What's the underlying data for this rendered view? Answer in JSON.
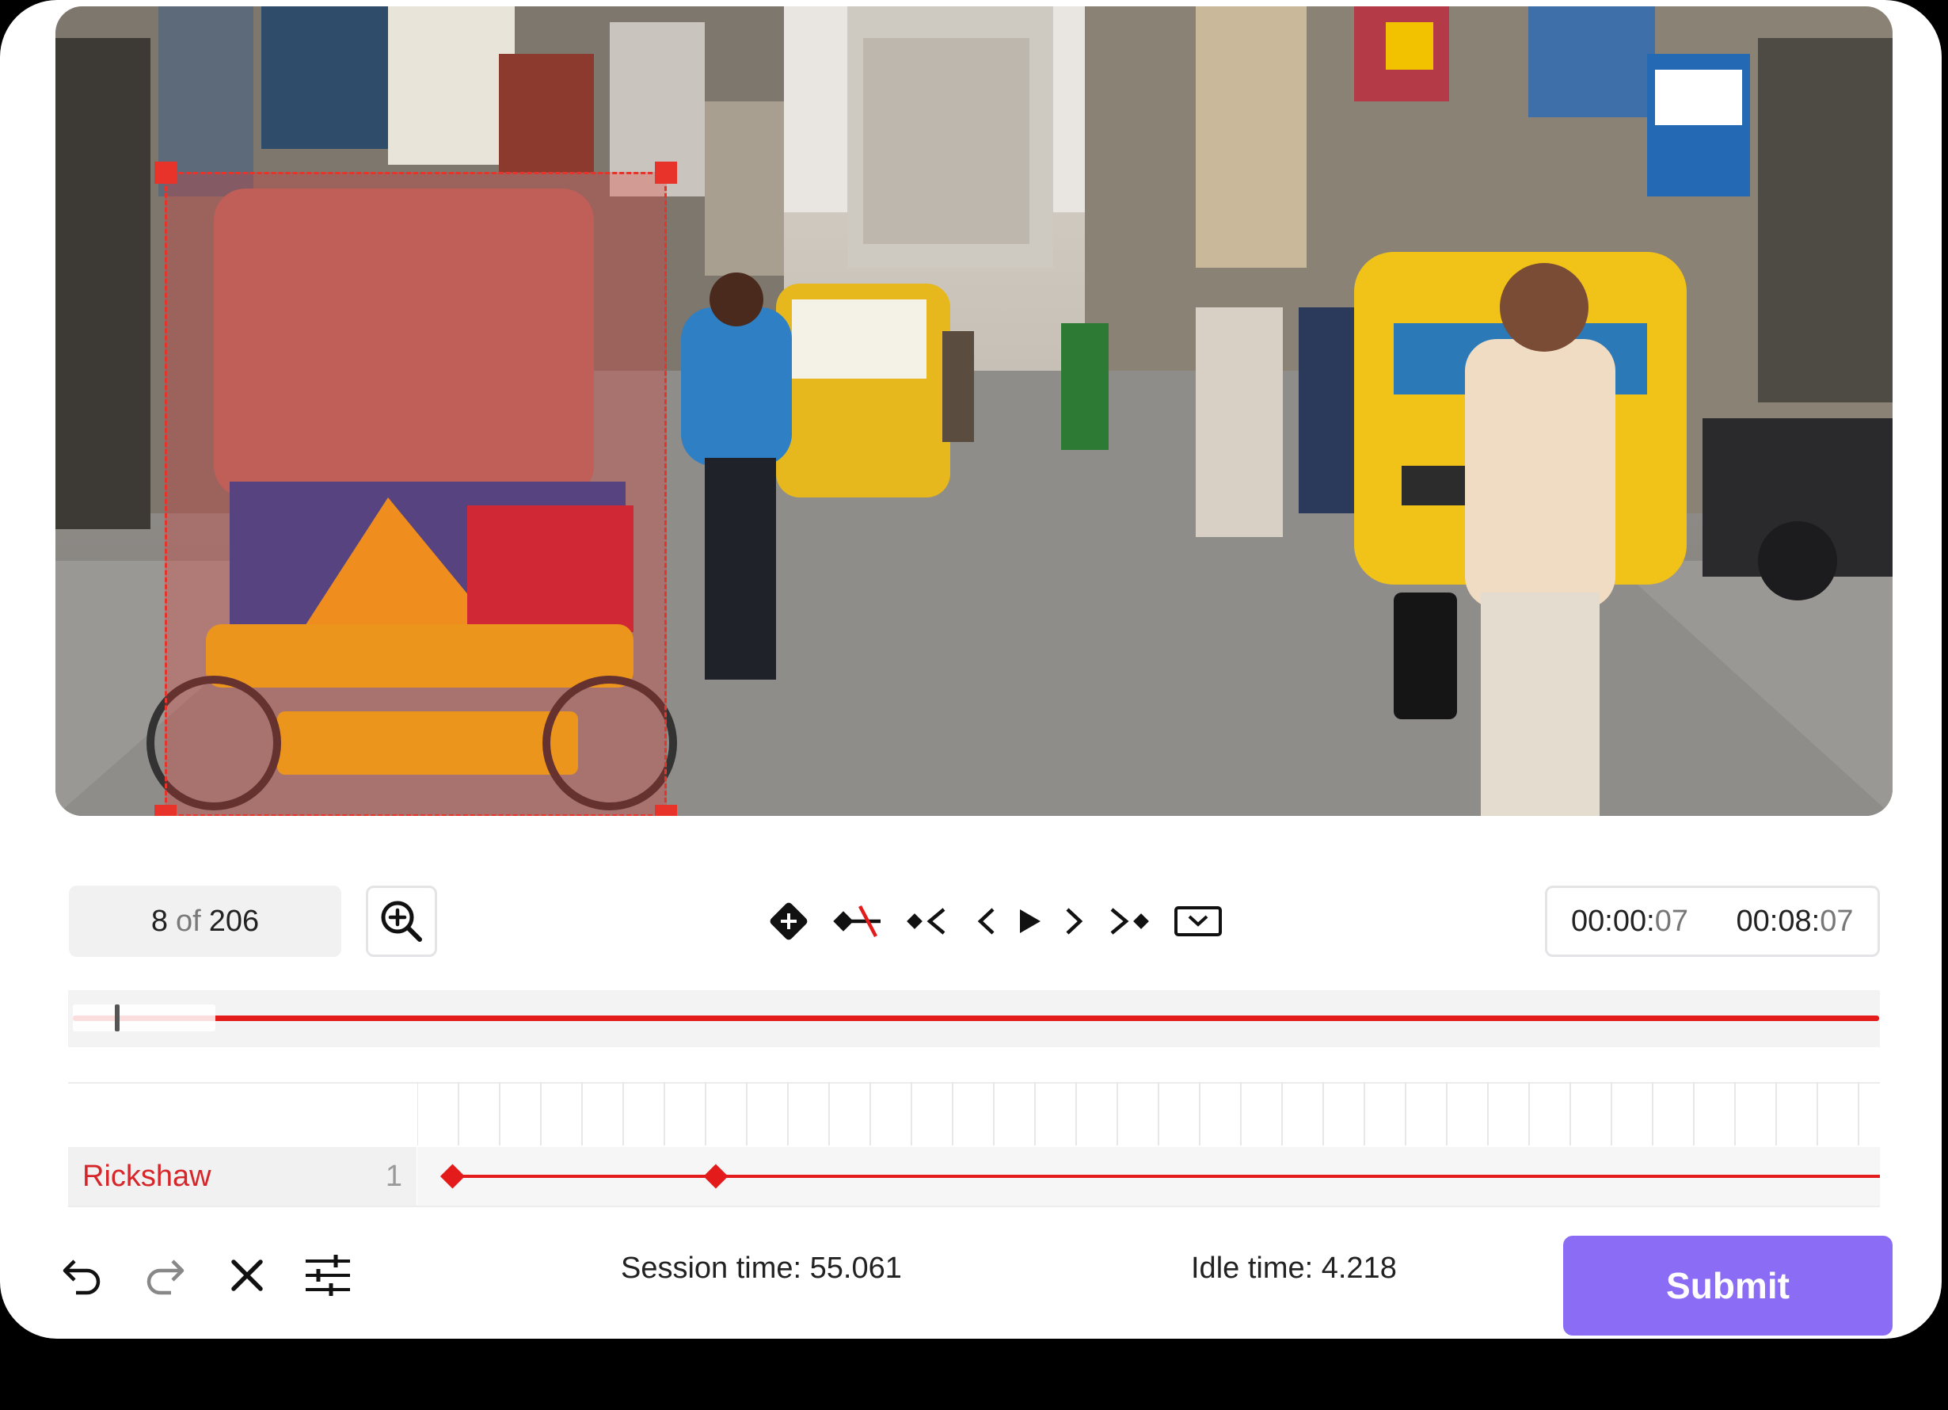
{
  "toolbar": {
    "frame_current": "8",
    "frame_of": "of",
    "frame_total": "206",
    "time_current_main": "00:00:",
    "time_current_ms": "07",
    "time_total_main": "00:08:",
    "time_total_ms": "07"
  },
  "scrubber": {
    "position": 0.04
  },
  "tracks": [
    {
      "label": "Rickshaw",
      "count": "1",
      "color": "#e31b1b",
      "keyframes": [
        0.01,
        0.19
      ]
    }
  ],
  "footer": {
    "session_time": "Session time: 55.061",
    "idle_time": "Idle time: 4.218",
    "submit_label": "Submit"
  },
  "colors": {
    "accent": "#8b6cf5",
    "annotation": "#e8332a"
  },
  "icons": [
    "zoom-in-icon",
    "add-keyframe-icon",
    "remove-keyframe-icon",
    "prev-keyframe-icon",
    "prev-frame-icon",
    "play-icon",
    "next-frame-icon",
    "next-keyframe-icon",
    "dropdown-icon",
    "undo-icon",
    "redo-icon",
    "close-icon",
    "settings-sliders-icon"
  ]
}
